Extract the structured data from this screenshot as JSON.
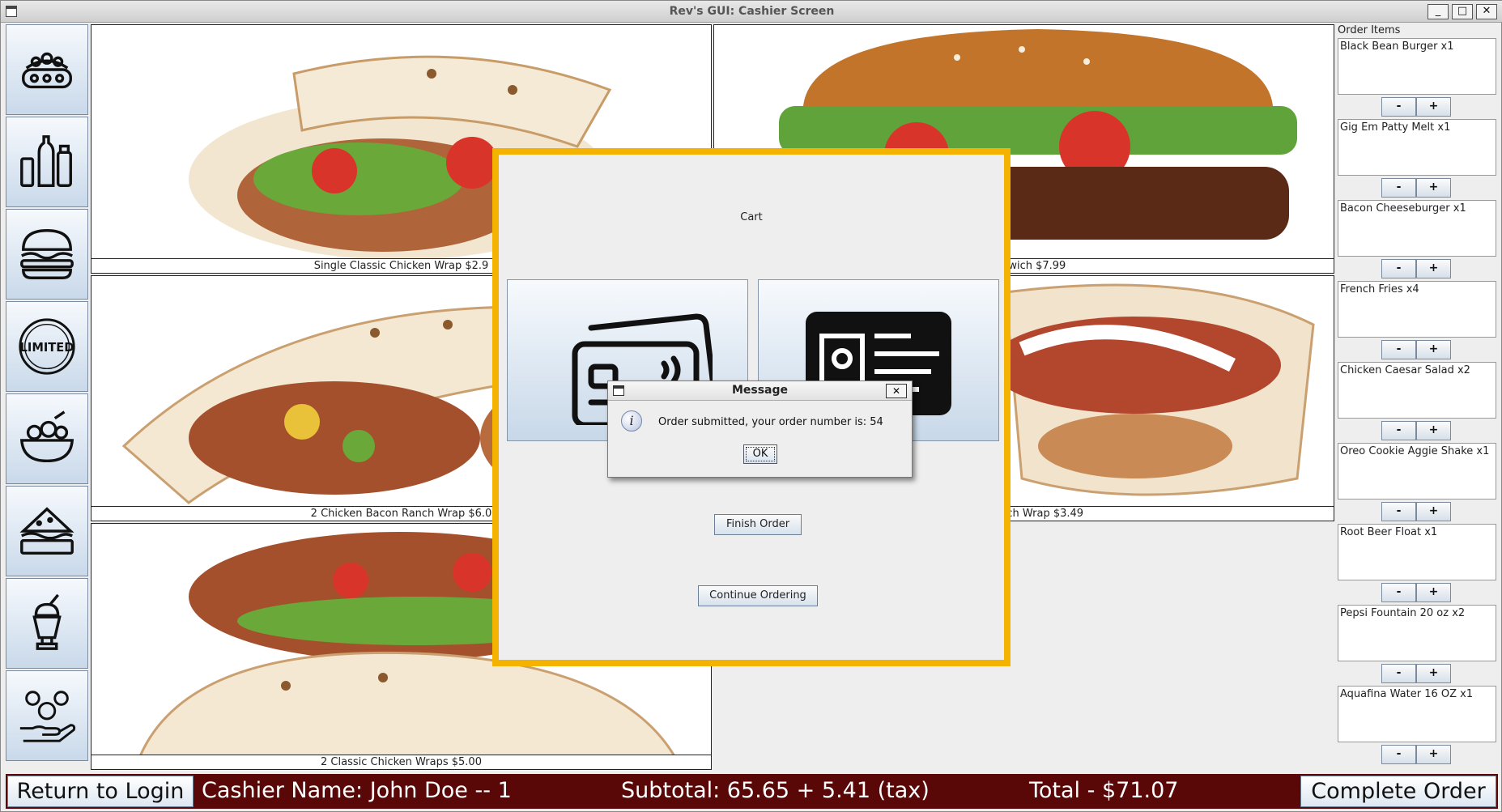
{
  "window": {
    "title": "Rev's GUI: Cashier Screen",
    "min_label": "_",
    "max_label": "□",
    "close_label": "✕"
  },
  "categories": [
    {
      "name": "entrees-icon"
    },
    {
      "name": "drinks-icon"
    },
    {
      "name": "burgers-icon"
    },
    {
      "name": "limited-icon",
      "text": "LIMITED"
    },
    {
      "name": "salads-icon"
    },
    {
      "name": "sandwiches-icon"
    },
    {
      "name": "shakes-icon"
    },
    {
      "name": "payment-icon"
    }
  ],
  "menu_tiles": [
    {
      "caption": "Single Classic Chicken Wrap  $2.9"
    },
    {
      "caption": " Sandwich  $7.99"
    },
    {
      "caption": "2 Chicken Bacon Ranch Wrap  $6.0"
    },
    {
      "caption": "con Ranch Wrap  $3.49"
    },
    {
      "caption": "2 Classic Chicken Wraps  $5.00"
    }
  ],
  "order_panel": {
    "header": "Order Items",
    "minus_label": "-",
    "plus_label": "+",
    "items": [
      {
        "name": "Black Bean Burger x1"
      },
      {
        "name": "Gig Em Patty Melt x1"
      },
      {
        "name": "Bacon Cheeseburger x1"
      },
      {
        "name": "French Fries x4"
      },
      {
        "name": "Chicken Caesar Salad x2"
      },
      {
        "name": "Oreo Cookie Aggie Shake x1"
      },
      {
        "name": "Root Beer Float x1"
      },
      {
        "name": "Pepsi Fountain 20 oz x2"
      },
      {
        "name": "Aquafina Water 16 OZ x1"
      }
    ]
  },
  "bottom_bar": {
    "return_label": "Return to Login",
    "cashier": "Cashier Name: John Doe -- 1",
    "subtotal": "Subtotal: 65.65 +  5.41 (tax)",
    "total": "Total - $71.07",
    "complete_label": "Complete Order"
  },
  "cart": {
    "title": "Cart",
    "finish_label": "Finish Order",
    "continue_label": "Continue Ordering"
  },
  "message": {
    "title": "Message",
    "text": "Order submitted, your order number is: 54",
    "ok_label": "OK",
    "close_label": "✕"
  },
  "colors": {
    "bottom_bar": "#5a0707",
    "cart_border": "#f5b301",
    "button_gradient_bottom": "#c9d9ea"
  }
}
